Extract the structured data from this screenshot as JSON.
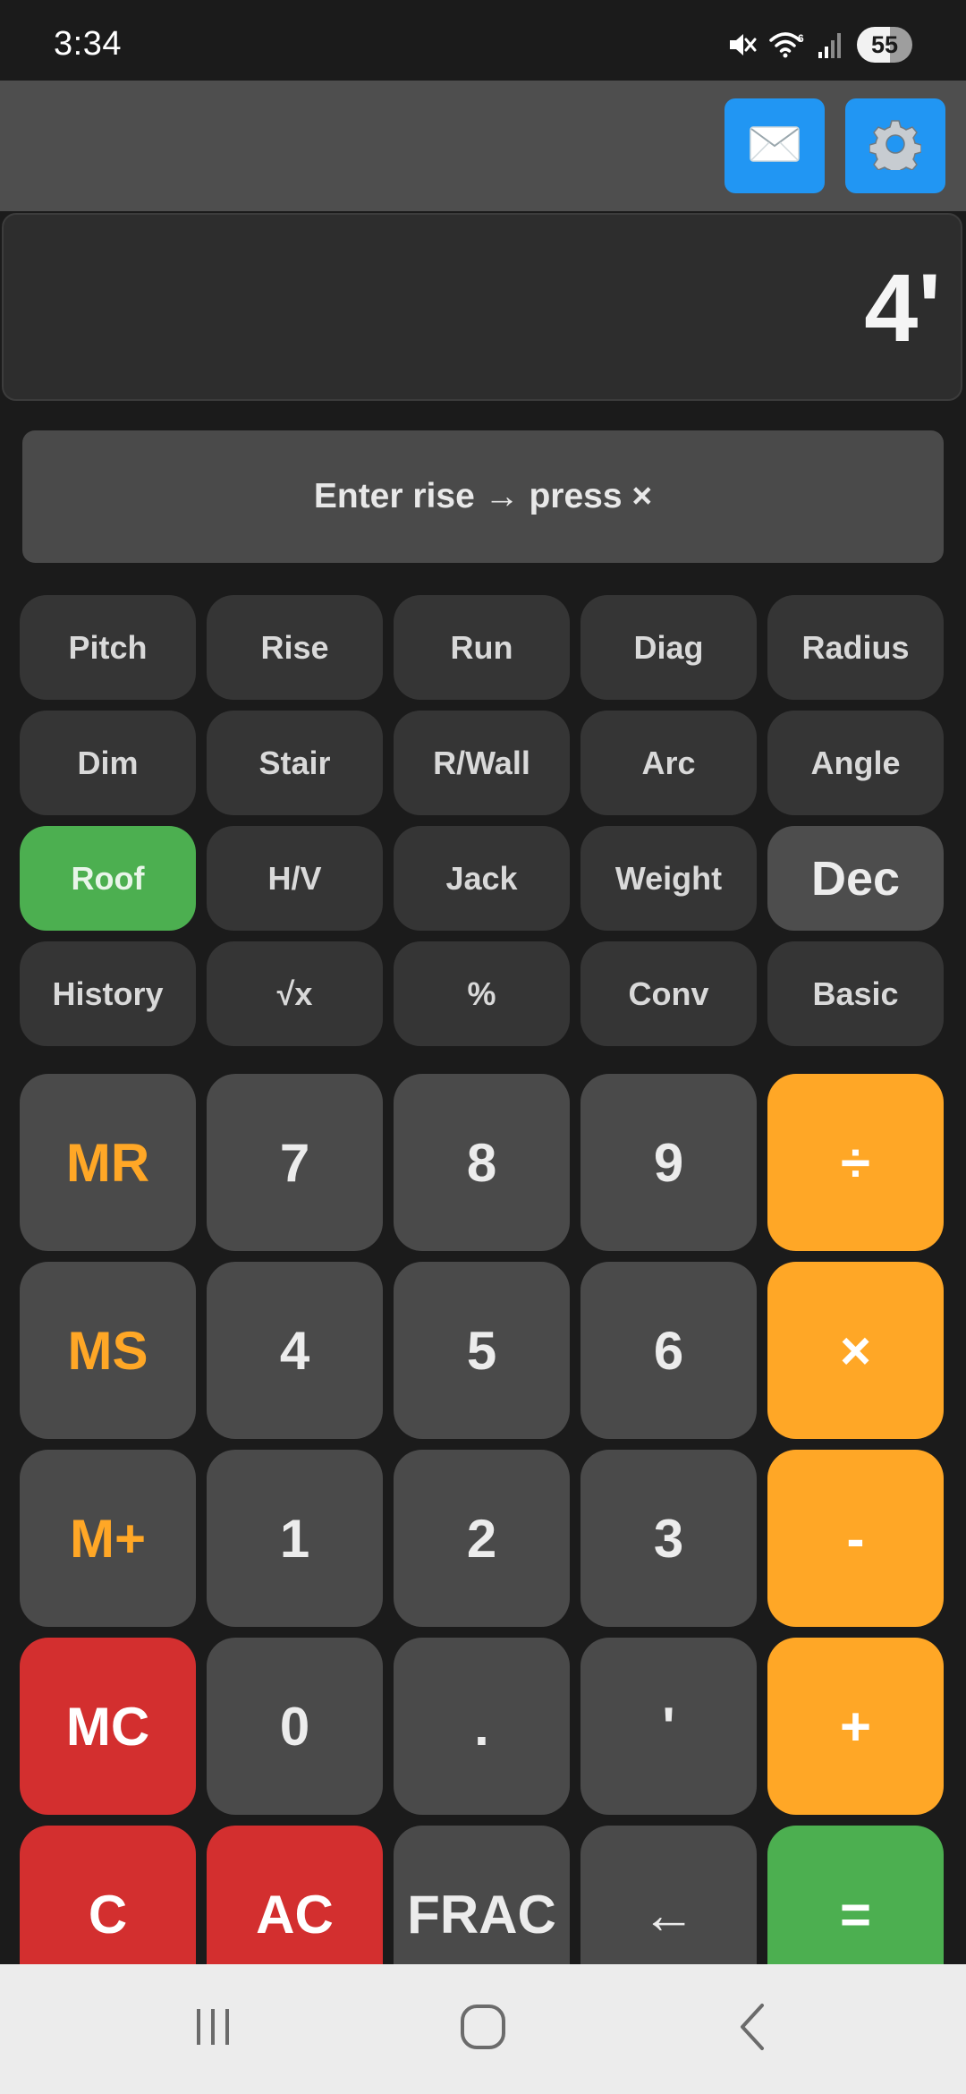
{
  "status": {
    "time": "3:34",
    "battery": "55",
    "wifi_label": "6"
  },
  "appbar": {
    "mail_icon": "envelope-icon",
    "settings_icon": "gear-icon",
    "accent": "#2196f3"
  },
  "display": {
    "value": "4'"
  },
  "hint": "Enter rise → press ×",
  "function_keys": [
    "Pitch",
    "Rise",
    "Run",
    "Diag",
    "Radius",
    "Dim",
    "Stair",
    "R/Wall",
    "Arc",
    "Angle",
    "Roof",
    "H/V",
    "Jack",
    "Weight",
    "Dec",
    "History",
    "√x",
    "%",
    "Conv",
    "Basic"
  ],
  "active_function": "Roof",
  "keypad": [
    "MR",
    "7",
    "8",
    "9",
    "÷",
    "MS",
    "4",
    "5",
    "6",
    "×",
    "M+",
    "1",
    "2",
    "3",
    "-",
    "MC",
    "0",
    ".",
    "'",
    "+",
    "C",
    "AC",
    "FRAC",
    "←",
    "="
  ],
  "colors": {
    "operator": "#ffa726",
    "clear": "#d32f2f",
    "equals": "#4caf50",
    "active_function": "#4caf50"
  },
  "navbar": {
    "recents_icon": "recent-apps-icon",
    "home_icon": "home-icon",
    "back_icon": "back-icon"
  }
}
